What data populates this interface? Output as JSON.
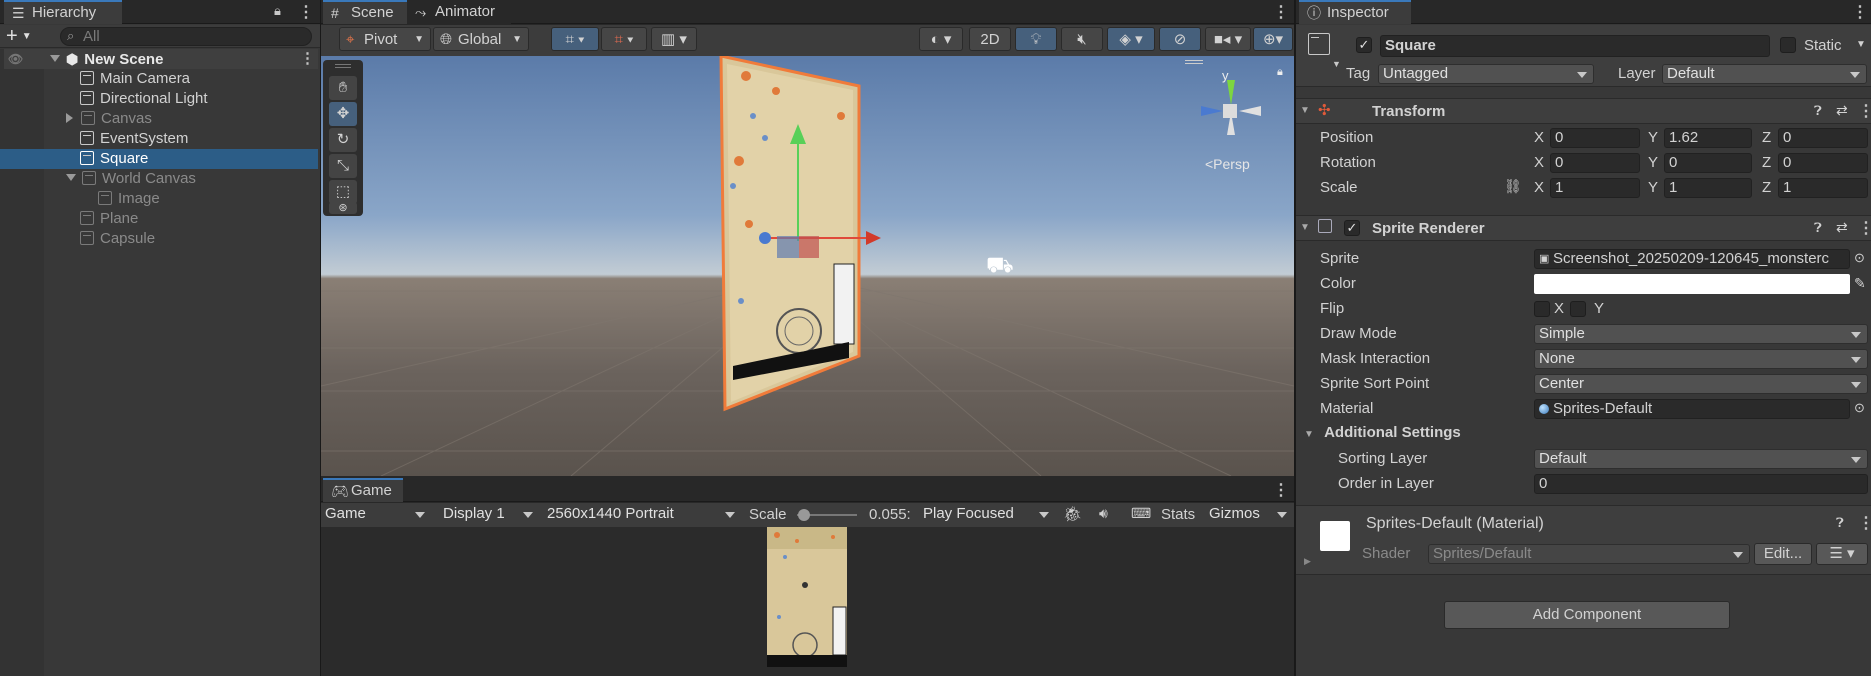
{
  "hierarchy": {
    "tab_label": "Hierarchy",
    "add_label": "+",
    "search_placeholder": "All",
    "scene_name": "New Scene",
    "items": [
      {
        "label": "Main Camera"
      },
      {
        "label": "Directional Light"
      },
      {
        "label": "Canvas"
      },
      {
        "label": "EventSystem"
      },
      {
        "label": "Square"
      },
      {
        "label": "World Canvas"
      },
      {
        "label": "Image"
      },
      {
        "label": "Plane"
      },
      {
        "label": "Capsule"
      }
    ]
  },
  "scene_view": {
    "tabs": [
      {
        "label": "Scene"
      },
      {
        "label": "Animator"
      }
    ],
    "pivot_label": "Pivot",
    "global_label": "Global",
    "mode_2d_label": "2D",
    "persp_label": "<Persp",
    "gizmo_y_label": "y"
  },
  "game_view": {
    "tab_label": "Game",
    "game_dropdown": "Game",
    "display_dropdown": "Display 1",
    "resolution_dropdown": "2560x1440 Portrait",
    "scale_label": "Scale",
    "scale_value": "0.055:",
    "scale_fraction": 0.05,
    "play_focused": "Play Focused",
    "stats_label": "Stats",
    "gizmos_label": "Gizmos"
  },
  "inspector": {
    "tab_label": "Inspector",
    "object_name": "Square",
    "static_label": "Static",
    "tag_label": "Tag",
    "tag_value": "Untagged",
    "layer_label": "Layer",
    "layer_value": "Default",
    "transform": {
      "title": "Transform",
      "rows": [
        {
          "label": "Position",
          "x": "0",
          "y": "1.62",
          "z": "0"
        },
        {
          "label": "Rotation",
          "x": "0",
          "y": "0",
          "z": "0"
        },
        {
          "label": "Scale",
          "x": "1",
          "y": "1",
          "z": "1"
        }
      ],
      "axis_x": "X",
      "axis_y": "Y",
      "axis_z": "Z"
    },
    "sprite_renderer": {
      "title": "Sprite Renderer",
      "sprite_label": "Sprite",
      "sprite_value": "Screenshot_20250209-120645_monsterc",
      "color_label": "Color",
      "color_value": "#ffffff",
      "flip_label": "Flip",
      "flip_x": "X",
      "flip_y": "Y",
      "draw_mode_label": "Draw Mode",
      "draw_mode_value": "Simple",
      "mask_label": "Mask Interaction",
      "mask_value": "None",
      "sort_point_label": "Sprite Sort Point",
      "sort_point_value": "Center",
      "material_label": "Material",
      "material_value": "Sprites-Default",
      "additional_label": "Additional Settings",
      "sorting_layer_label": "Sorting Layer",
      "sorting_layer_value": "Default",
      "order_label": "Order in Layer",
      "order_value": "0"
    },
    "material": {
      "title": "Sprites-Default (Material)",
      "shader_label": "Shader",
      "shader_value": "Sprites/Default",
      "edit_label": "Edit..."
    },
    "add_component_label": "Add Component"
  },
  "colors": {
    "accent": "#3a79bb",
    "selection": "#2c5d87",
    "panel": "#383838",
    "outline_orange": "#f07b3a"
  }
}
